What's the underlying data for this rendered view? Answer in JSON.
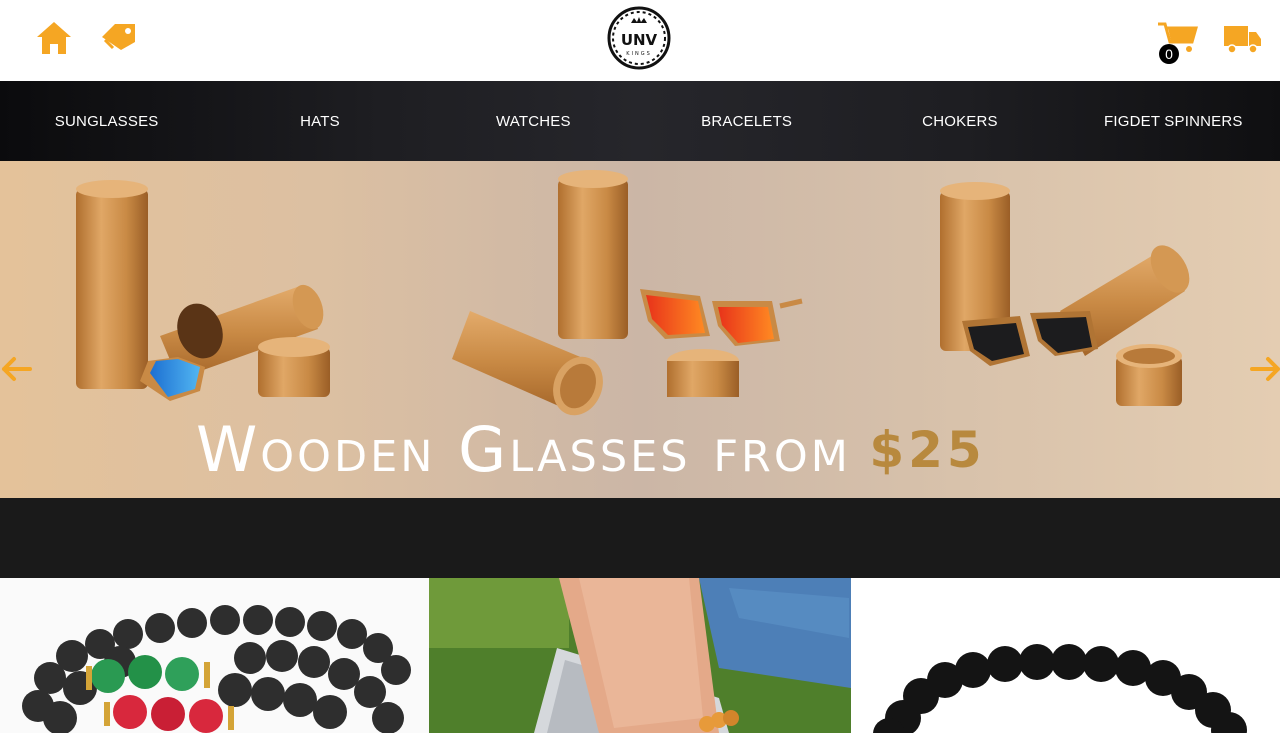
{
  "header": {
    "home_icon": "home-icon",
    "tag_icon": "tag-icon",
    "logo_text": "UNV",
    "logo_subtext": "KINGS",
    "cart_icon": "cart-icon",
    "cart_count": "0",
    "shipping_icon": "truck-icon"
  },
  "nav": {
    "items": [
      {
        "label": "SUNGLASSES"
      },
      {
        "label": "HATS"
      },
      {
        "label": "WATCHES"
      },
      {
        "label": "BRACELETS"
      },
      {
        "label": "CHOKERS"
      },
      {
        "label": "FIGDET SPINNERS"
      }
    ]
  },
  "banner": {
    "headline": "Wooden Glasses from",
    "price": "$25",
    "prev_icon": "arrow-left-icon",
    "next_icon": "arrow-right-icon"
  },
  "colors": {
    "accent": "#F5A623",
    "nav_bg": "#1E1E22",
    "strip_bg": "#1A1A1A",
    "price_gold": "#B8893E"
  }
}
